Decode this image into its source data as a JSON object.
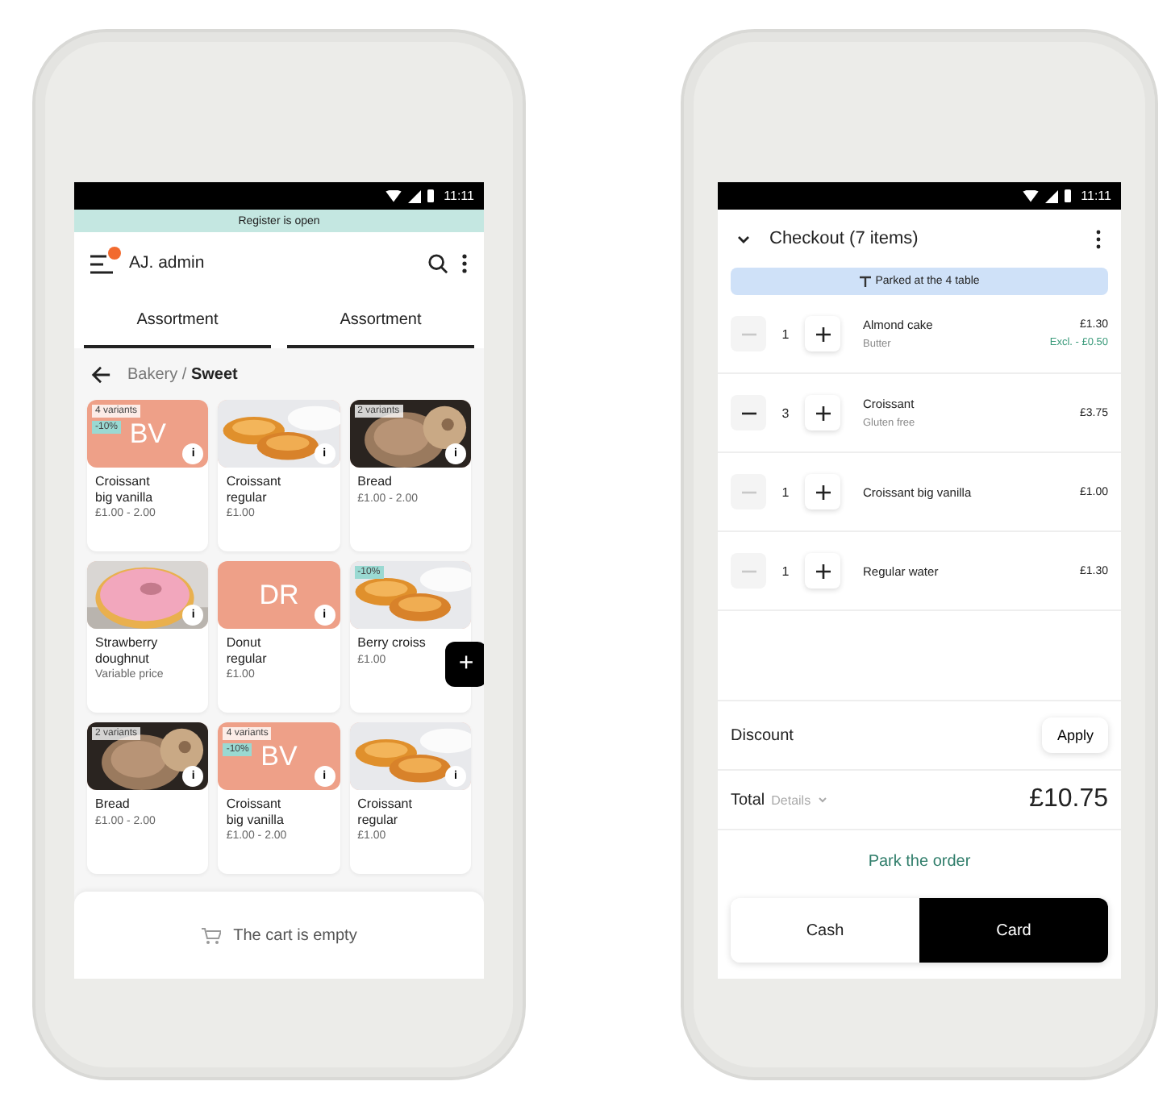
{
  "left_screen": {
    "status_bar": {
      "time": "11:11"
    },
    "banner": "Register is open",
    "header": {
      "user": "AJ. admin"
    },
    "tabs": [
      {
        "label": "Assortment",
        "selected": true
      },
      {
        "label": "Assortment",
        "selected": true
      }
    ],
    "breadcrumb": "Bakery / **Sweet**",
    "products": [
      {
        "kind": "placeholder",
        "initials": "BV",
        "tags": [
          {
            "text": "4 variants",
            "kind": "variants"
          },
          {
            "text": "-10%",
            "kind": "discount"
          }
        ],
        "info": "i",
        "name": "Croissant big vanilla",
        "price": "£1.00 - 2.00"
      },
      {
        "kind": "picture",
        "info": "i",
        "name": "Croissant regular",
        "price": "£1.00"
      },
      {
        "kind": "picture",
        "tags": [
          {
            "text": "2 variants",
            "kind": "variants"
          }
        ],
        "info": "i",
        "name": "Bread",
        "price": "£1.00 - 2.00"
      },
      {
        "kind": "picture",
        "info": "i",
        "name": "Strawberry doughnut",
        "price": "Variable price"
      },
      {
        "kind": "placeholder",
        "initials": "DR",
        "info": "i",
        "name": "Donut regular",
        "price": "£1.00"
      },
      {
        "kind": "picture",
        "tags": [
          {
            "text": "-10%",
            "kind": "discount"
          }
        ],
        "name": "Berry croiss",
        "price": "£1.00"
      },
      {
        "kind": "picture",
        "tags": [
          {
            "text": "2 variants",
            "kind": "variants"
          }
        ],
        "info": "i",
        "name": "Bread",
        "price": "£1.00 - 2.00"
      },
      {
        "kind": "placeholder",
        "initials": "BV",
        "tags": [
          {
            "text": "4 variants",
            "kind": "variants"
          },
          {
            "text": "-10%",
            "kind": "discount"
          }
        ],
        "info": "i",
        "name": "Croissant big vanilla",
        "price": "£1.00 - 2.00"
      },
      {
        "kind": "picture",
        "info": "i",
        "name": "Croissant regular",
        "price": "£1.00"
      }
    ],
    "fab": "+",
    "cart": "The cart is empty"
  },
  "right_screen": {
    "status_bar": {
      "time": "11:11"
    },
    "header": {
      "title": "Checkout (7 items)"
    },
    "banner": "Parked at the 4 table",
    "items": [
      {
        "qty": "1",
        "name": "Almond cake",
        "modifier": "Butter",
        "price": "£1.30",
        "extra": "Excl. - £0.50",
        "minus_disabled": true
      },
      {
        "qty": "3",
        "name": "Croissant",
        "modifier": "Gluten free",
        "price": "£3.75",
        "minus_disabled": false
      },
      {
        "qty": "1",
        "name": "Croissant big vanilla",
        "price": "£1.00",
        "minus_disabled": true
      },
      {
        "qty": "1",
        "name": "Regular water",
        "price": "£1.30",
        "minus_disabled": true
      }
    ],
    "discount": {
      "label": "Discount",
      "button": "Apply"
    },
    "total": {
      "label": "Total",
      "details": "Details",
      "amount": "£10.75"
    },
    "park": "Park the order",
    "payments": [
      {
        "label": "Cash",
        "selected": false
      },
      {
        "label": "Card",
        "selected": true
      }
    ]
  }
}
